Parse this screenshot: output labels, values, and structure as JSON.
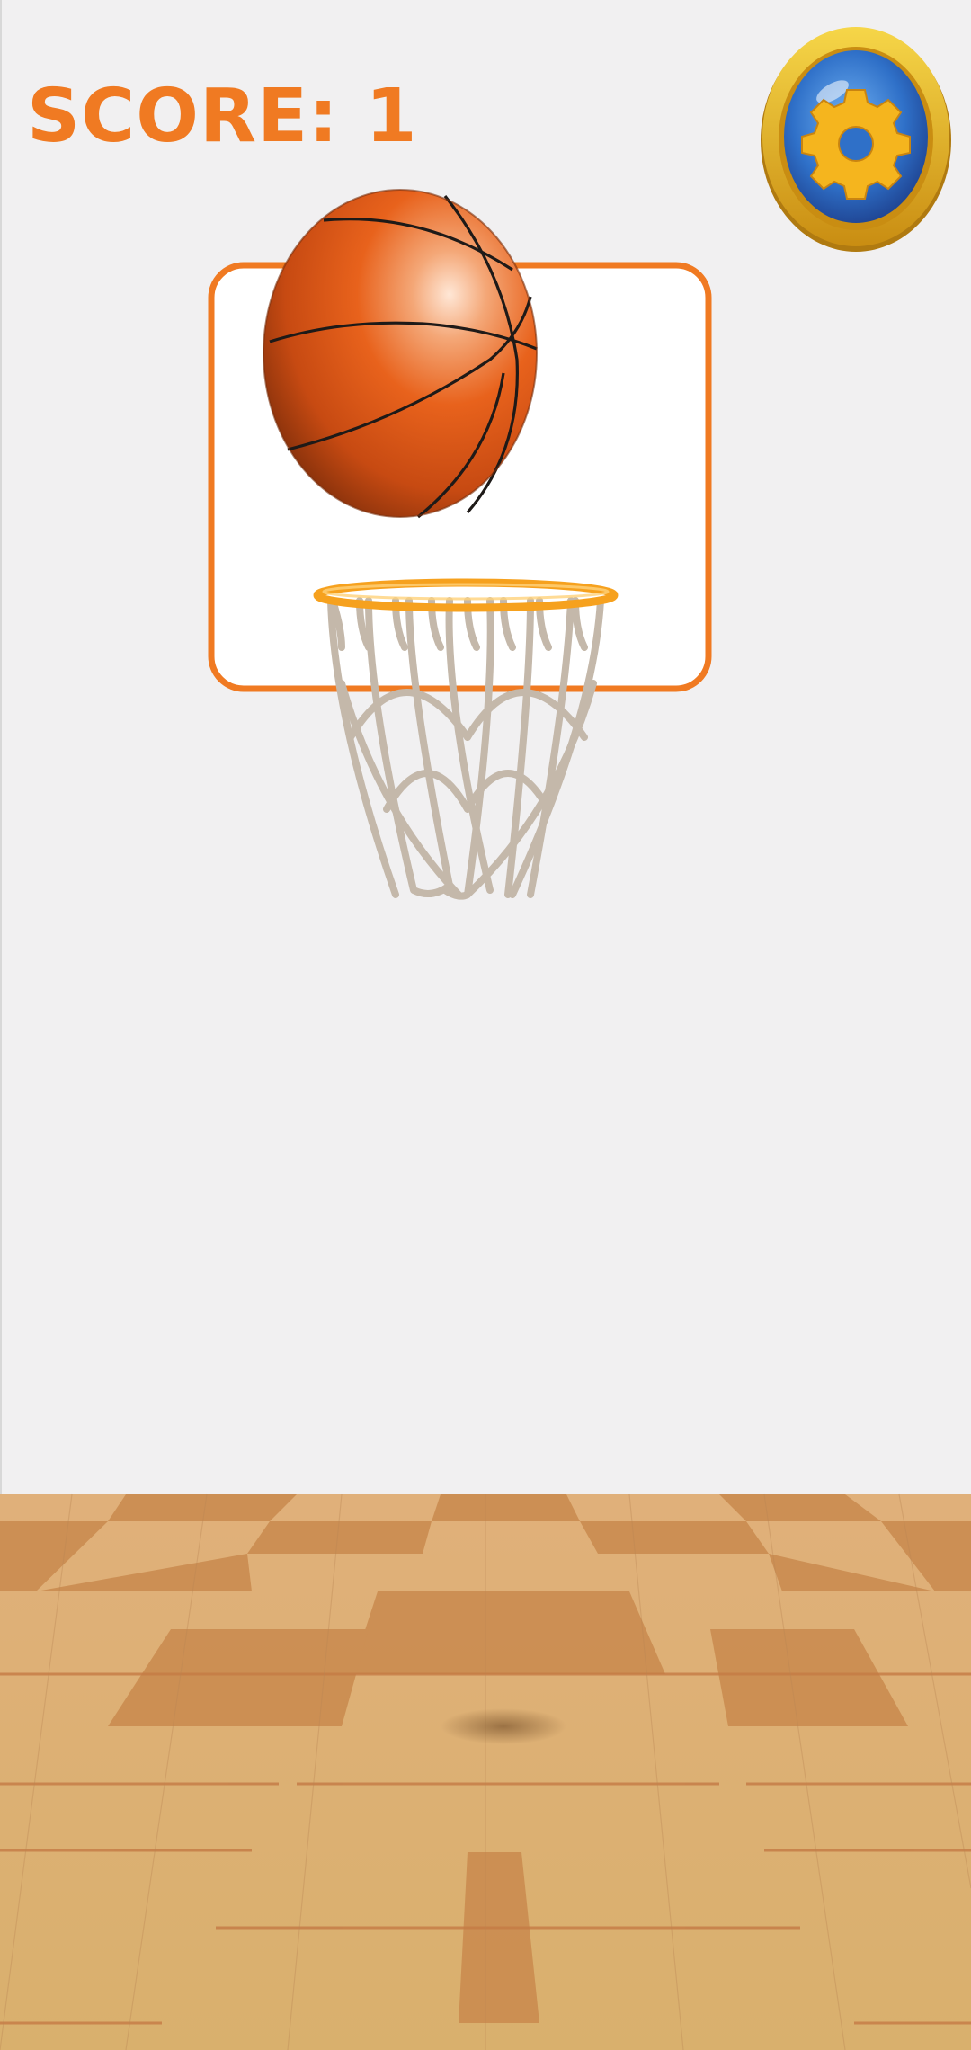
{
  "hud": {
    "score_label": "SCORE: 1"
  },
  "settings_button": {
    "icon": "gear-icon"
  },
  "colors": {
    "wall": "#f1f0f1",
    "accent_orange": "#f07a22",
    "backboard": "#ffffff",
    "rim": "#f6a11e",
    "net": "#c4b8aa",
    "floor_light": "#d8ae6e",
    "floor_dark": "#c98a4e",
    "settings_blue": "#2f70c8",
    "settings_gold": "#e6b21c"
  }
}
